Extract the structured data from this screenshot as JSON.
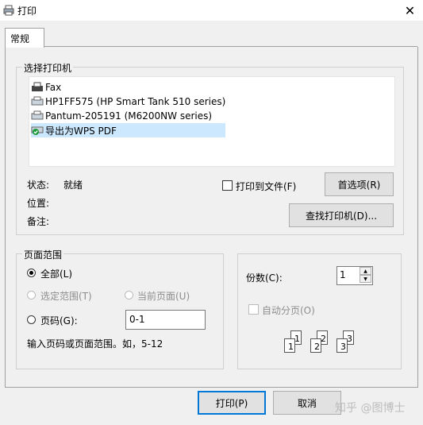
{
  "window": {
    "title": "打印",
    "close_glyph": "✕"
  },
  "tabs": [
    {
      "label": "常规",
      "active": true
    }
  ],
  "printer_group": {
    "label": "选择打印机",
    "printers": [
      {
        "name": "Fax",
        "selected": false
      },
      {
        "name": "HP1FF575 (HP Smart Tank 510 series)",
        "selected": false
      },
      {
        "name": "Pantum-205191 (M6200NW series)",
        "selected": false
      },
      {
        "name": "导出为WPS PDF",
        "selected": true
      }
    ],
    "status_label": "状态:",
    "status_value": "就绪",
    "location_label": "位置:",
    "comment_label": "备注:",
    "print_to_file_label": "打印到文件(F)",
    "print_to_file_checked": false,
    "preferences_button": "首选项(R)",
    "find_printer_button": "查找打印机(D)..."
  },
  "page_range": {
    "label": "页面范围",
    "all_label": "全部(L)",
    "selection_label": "选定范围(T)",
    "current_page_label": "当前页面(U)",
    "pages_label": "页码(G):",
    "pages_value": "0-1",
    "hint": "输入页码或页面范围。如，5-12",
    "selected": "all"
  },
  "copies": {
    "label": "份数(C):",
    "value": "1",
    "collate_label": "自动分页(O)",
    "collate_checked": false,
    "collate_pages": [
      "1",
      "1",
      "2",
      "2",
      "3",
      "3"
    ]
  },
  "buttons": {
    "print": "打印(P)",
    "cancel": "取消"
  },
  "watermark": "知乎 @图博士"
}
